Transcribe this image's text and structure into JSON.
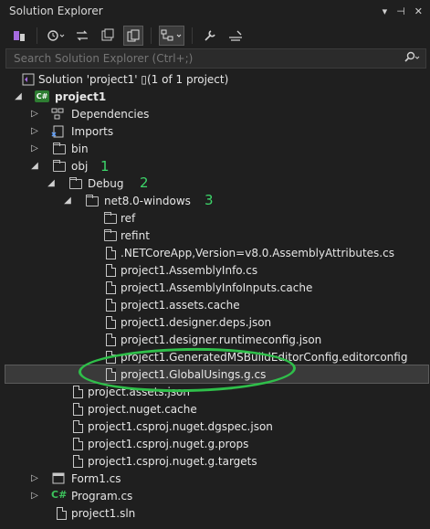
{
  "window": {
    "title": "Solution Explorer",
    "controls": [
      "▾",
      "⊣",
      "✕"
    ]
  },
  "toolbar": {
    "buttons": [
      "vs-switch-icon",
      "history-icon",
      "sync-icon",
      "collapse-icon",
      "show-all-icon",
      "preview-icon",
      "properties-icon",
      "preview-selected-icon"
    ]
  },
  "search": {
    "placeholder": "Search Solution Explorer (Ctrl+;)",
    "value": ""
  },
  "tree": {
    "solution": "Solution 'project1' ▯(1 of 1 project)",
    "project": "project1",
    "dependencies": "Dependencies",
    "imports": "Imports",
    "bin": "bin",
    "obj": "obj",
    "debug": "Debug",
    "net8": "net8.0-windows",
    "ref": "ref",
    "refint": "refint",
    "f1": ".NETCoreApp,Version=v8.0.AssemblyAttributes.cs",
    "f2": "project1.AssemblyInfo.cs",
    "f3": "project1.AssemblyInfoInputs.cache",
    "f4": "project1.assets.cache",
    "f5": "project1.designer.deps.json",
    "f6": "project1.designer.runtimeconfig.json",
    "f7": "project1.GeneratedMSBuildEditorConfig.editorconfig",
    "f8": "project1.GlobalUsings.g.cs",
    "o1": "project.assets.json",
    "o2": "project.nuget.cache",
    "o3": "project1.csproj.nuget.dgspec.json",
    "o4": "project1.csproj.nuget.g.props",
    "o5": "project1.csproj.nuget.g.targets",
    "form1": "Form1.cs",
    "program": "Program.cs",
    "sln": "project1.sln"
  },
  "annotations": {
    "n1": "1",
    "n2": "2",
    "n3": "3"
  },
  "colors": {
    "accent": "#2fbf4a",
    "selected": "#3a3a3a"
  }
}
